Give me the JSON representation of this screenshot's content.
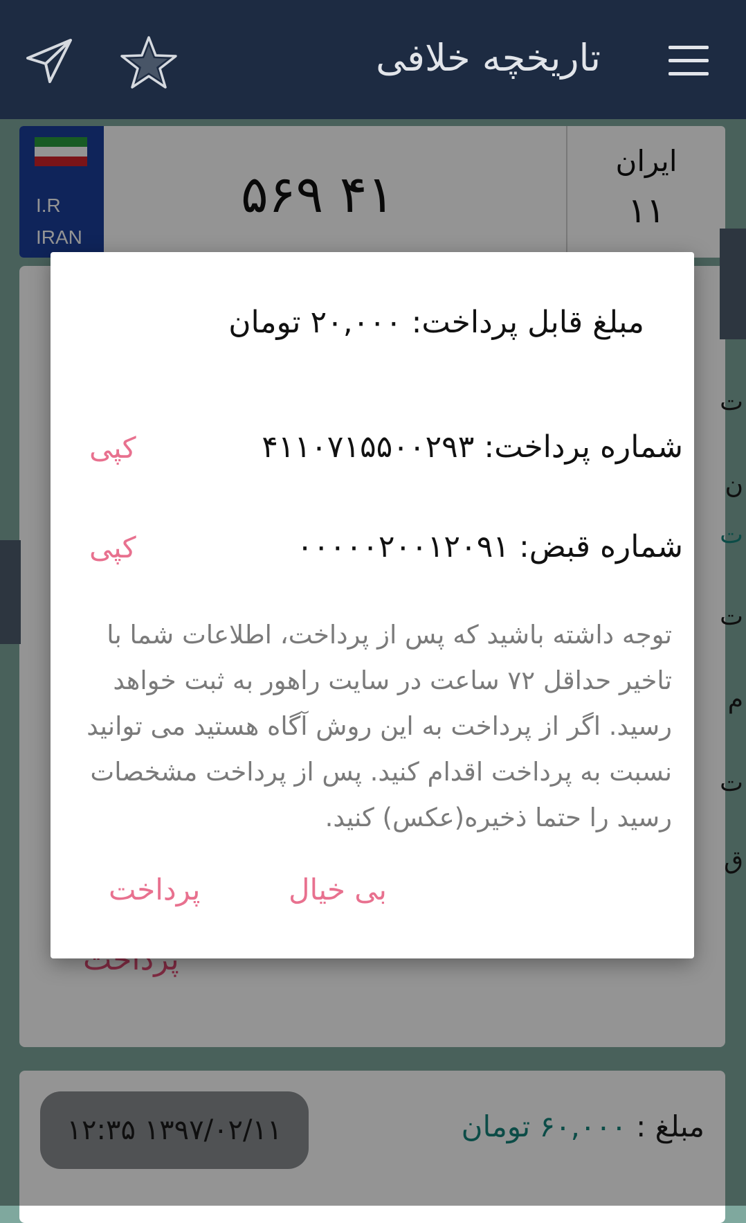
{
  "header": {
    "title": "تاریخچه خلافی",
    "icons": {
      "menu": "hamburger-icon",
      "favorite": "star-icon",
      "share": "send-icon"
    }
  },
  "plate": {
    "country_line1": "I.R",
    "country_line2": "IRAN",
    "number": "۴۱ ۵۶۹",
    "region_name": "ایران",
    "region_code": "۱۱"
  },
  "background": {
    "card_pay_label": "پرداخت",
    "last_amount_label": "مبلغ :",
    "last_amount_value": "۶۰,۰۰۰ تومان",
    "last_date": "۱۳۹۷/۰۲/۱۱ ۱۲:۳۵",
    "side_fragments": [
      "ت",
      "ن",
      "ت",
      "ت",
      "م",
      "ت",
      "ق"
    ]
  },
  "dialog": {
    "amount_text": "مبلغ قابل پرداخت: ۲۰,۰۰۰ تومان",
    "payment_id_text": "شماره پرداخت: ۴۱۱۰۷۱۵۵۰۰۲۹۳",
    "bill_id_text": "شماره قبض: ۰۰۰۰۰۲۰۰۱۲۰۹۱",
    "copy_label": "کپی",
    "note": "توجه داشته باشید که پس از پرداخت، اطلاعات شما با تاخیر حداقل ۷۲ ساعت در سایت راهور به ثبت خواهد رسید. اگر از پرداخت به این روش آگاه هستید می توانید نسبت به پرداخت اقدام کنید. پس از پرداخت مشخصات رسید را حتما ذخیره(عکس) کنید.",
    "cancel_label": "بی خیال",
    "pay_label": "پرداخت"
  },
  "colors": {
    "header_bg": "#1d2b42",
    "accent_pink": "#e8718f",
    "amount_teal": "#16847a",
    "page_bg": "#7fa89e"
  }
}
